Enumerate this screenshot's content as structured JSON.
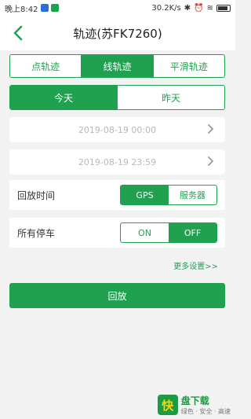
{
  "status_bar": {
    "time": "晚上8:42",
    "network_speed": "30.2K/s",
    "battery": ""
  },
  "header": {
    "title": "轨迹(苏FK7260)"
  },
  "track_type_tabs": [
    {
      "label": "点轨迹",
      "active": false
    },
    {
      "label": "线轨迹",
      "active": true
    },
    {
      "label": "平滑轨迹",
      "active": false
    }
  ],
  "day_tabs": [
    {
      "label": "今天",
      "active": true
    },
    {
      "label": "昨天",
      "active": false
    }
  ],
  "time_range": {
    "start": "2019-08-19 00:00",
    "end": "2019-08-19 23:59"
  },
  "playback_time": {
    "label": "回放时间",
    "options": [
      "GPS",
      "服务器"
    ],
    "selected": "GPS"
  },
  "all_parking": {
    "label": "所有停车",
    "options": [
      "ON",
      "OFF"
    ],
    "selected": "OFF"
  },
  "more_settings": "更多设置>>",
  "playback_button": "回放",
  "watermark": {
    "logo": "快",
    "name": "盘下载",
    "tagline": "绿色 · 安全 · 高速"
  },
  "colors": {
    "accent": "#20a150",
    "background": "#f2f2f2",
    "placeholder_text": "#b8b8b8"
  }
}
